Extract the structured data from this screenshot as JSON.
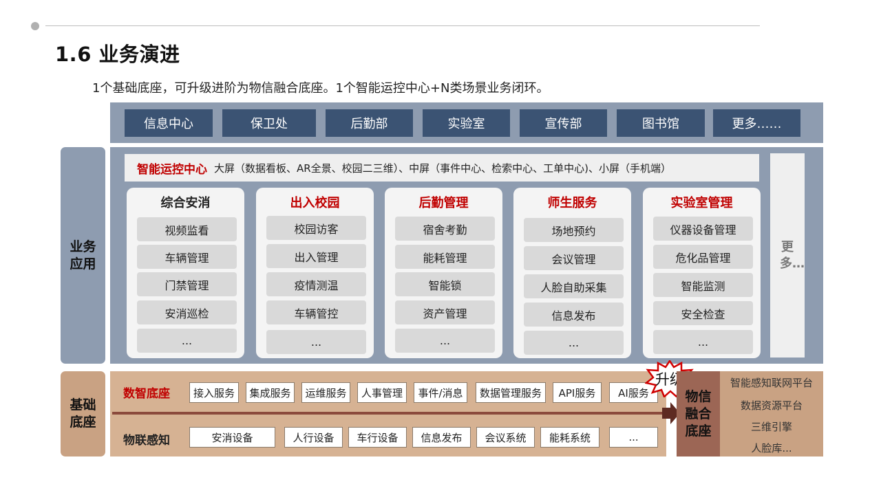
{
  "header": {
    "title": "1.6 业务演进",
    "subtitle": "1个基础底座，可升级进阶为物信融合底座。1个智能运控中心+N类场景业务闭环。"
  },
  "departments": [
    "信息中心",
    "保卫处",
    "后勤部",
    "实验室",
    "宣传部",
    "图书馆",
    "更多……"
  ],
  "business": {
    "label": "业务应用",
    "ops_center": {
      "title": "智能运控中心",
      "desc": "大屏（数据看板、AR全景、校园二三维）、中屏（事件中心、检索中心、工单中心)、小屏（手机端）"
    },
    "cards": [
      {
        "title": "综合安消",
        "items": [
          "视频监看",
          "车辆管理",
          "门禁管理",
          "安消巡检",
          "..."
        ]
      },
      {
        "title": "出入校园",
        "items": [
          "校园访客",
          "出入管理",
          "疫情测温",
          "车辆管控",
          "..."
        ]
      },
      {
        "title": "后勤管理",
        "items": [
          "宿舍考勤",
          "能耗管理",
          "智能锁",
          "资产管理",
          "..."
        ]
      },
      {
        "title": "师生服务",
        "items": [
          "场地预约",
          "会议管理",
          "人脸自助采集",
          "信息发布",
          "..."
        ]
      },
      {
        "title": "实验室管理",
        "items": [
          "仪器设备管理",
          "危化品管理",
          "智能监测",
          "安全检查",
          "..."
        ]
      }
    ],
    "more": "更多…"
  },
  "base": {
    "label": "基础底座",
    "data_row": {
      "label": "数智底座",
      "services": [
        "接入服务",
        "集成服务",
        "运维服务",
        "人事管理",
        "事件/消息",
        "数据管理服务",
        "API服务",
        "AI服务"
      ]
    },
    "iot_row": {
      "label": "物联感知",
      "devices": [
        "安消设备",
        "人行设备",
        "车行设备",
        "信息发布",
        "会议系统",
        "能耗系统",
        "..."
      ]
    },
    "upgrade": "升级",
    "fusion_label": "物信融合底座",
    "platforms": [
      "智能感知联网平台",
      "数据资源平台",
      "三维引擎",
      "人脸库..."
    ]
  },
  "colors": {
    "accent_red": "#c00000",
    "dept_blue": "#3b5373",
    "layer_gray_blue": "#8e9cb0",
    "base_tan": "#d6b293",
    "fusion_brown": "#9c6655"
  }
}
